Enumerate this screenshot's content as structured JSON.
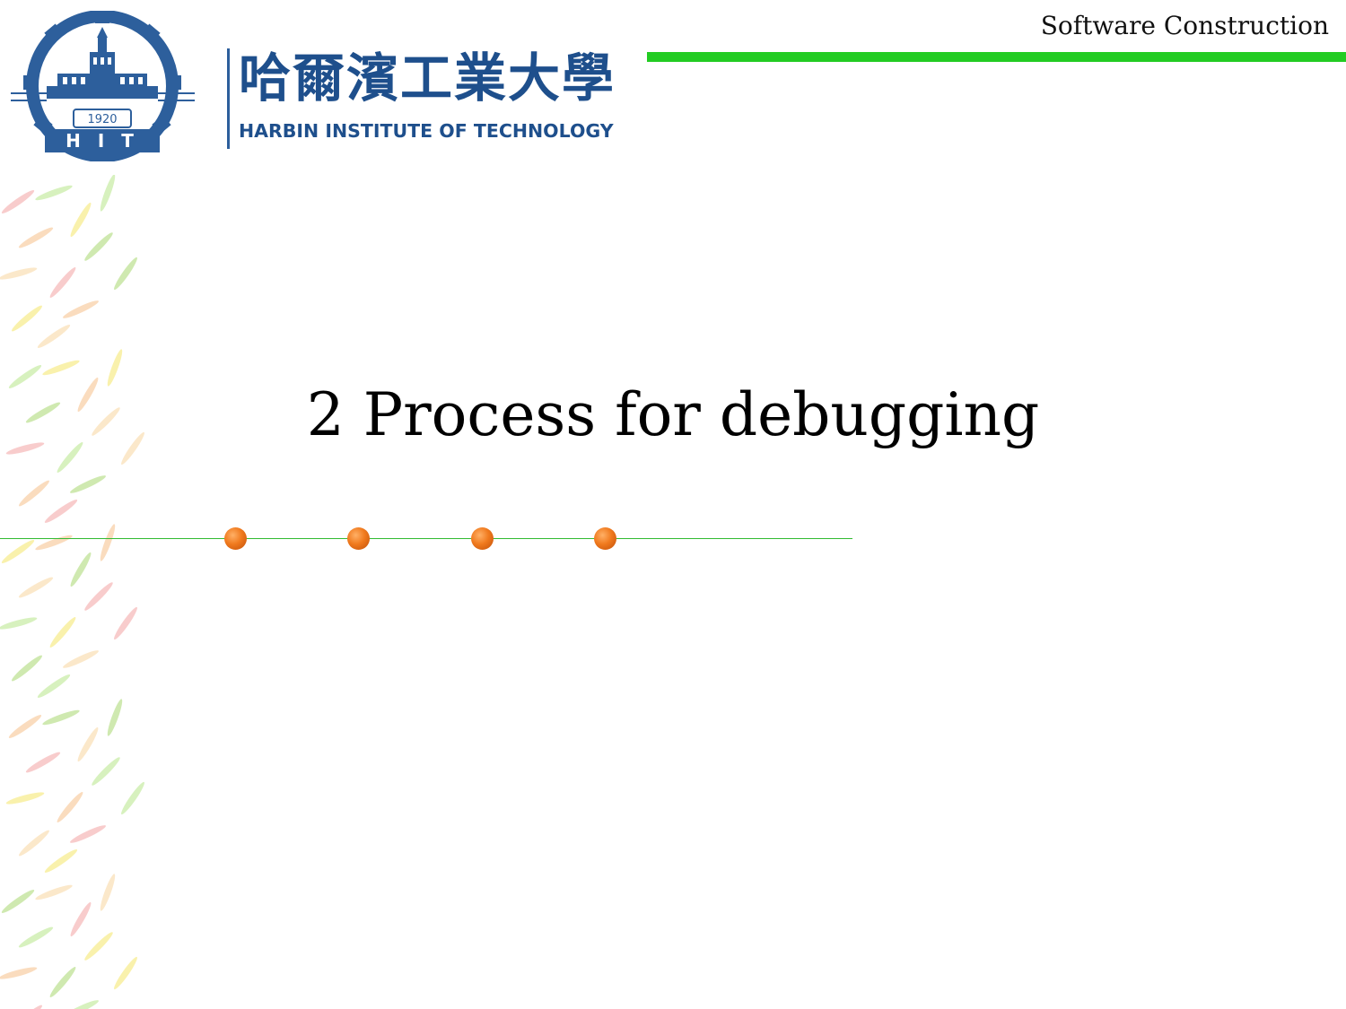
{
  "header": {
    "course_title": "Software Construction",
    "accent_color": "#22cc22"
  },
  "logo": {
    "year": "1920",
    "initials": "H I T",
    "name_cn": "哈爾濱工業大學",
    "name_en": "HARBIN INSTITUTE OF TECHNOLOGY",
    "color": "#1e4f8c"
  },
  "slide": {
    "title": "2 Process for debugging"
  },
  "decor": {
    "dot_count": 4,
    "dot_color": "#f07a1e",
    "line_color": "#33bb33"
  }
}
